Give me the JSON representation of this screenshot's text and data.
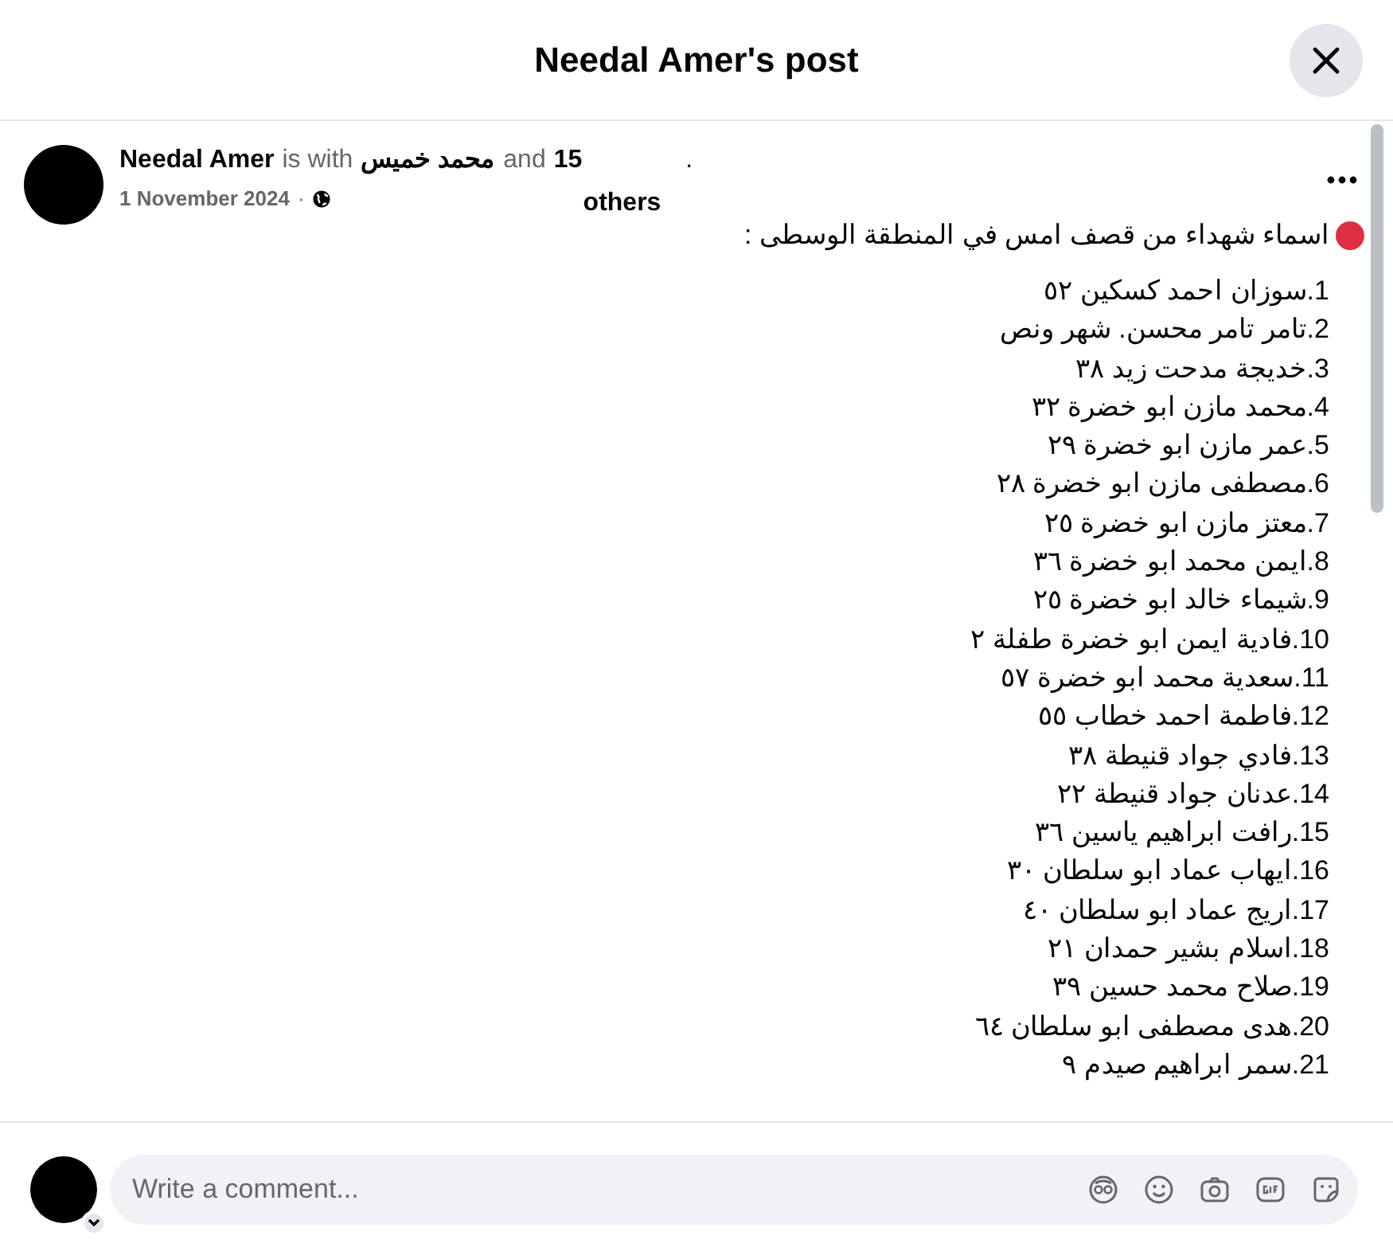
{
  "dialog": {
    "title": "Needal Amer's post"
  },
  "post": {
    "author": "Needal Amer",
    "with_text": "is with",
    "tagged": "محمد خميس",
    "and_text": "and",
    "count": "15",
    "dot": ".",
    "others": "others",
    "date": "1 November 2024",
    "separator": "·",
    "headline": "اسماء شهداء من قصف امس في المنطقة الوسطى  :",
    "lines": [
      "1.سوزان احمد كسكين ٥٢",
      "2.تامر تامر محسن. شهر ونص",
      "3.خديجة مدحت زيد ٣٨",
      "4.محمد مازن ابو خضرة ٣٢",
      "5.عمر مازن ابو خضرة ٢٩",
      "6.مصطفى مازن ابو خضرة ٢٨",
      "7.معتز مازن ابو خضرة ٢٥",
      "8.ايمن محمد ابو خضرة ٣٦",
      "9.شيماء خالد ابو خضرة ٢٥",
      "10.فادية ايمن ابو خضرة طفلة ٢",
      "11.سعدية محمد ابو خضرة ٥٧",
      "12.فاطمة احمد خطاب ٥٥",
      "13.فادي جواد قنيطة ٣٨",
      "14.عدنان جواد قنيطة ٢٢",
      "15.رافت ابراهيم ياسين ٣٦",
      "16.ايهاب عماد ابو سلطان ٣٠",
      "17.اريج عماد ابو سلطان ٤٠",
      "18.اسلام بشير حمدان ٢١",
      "19.صلاح محمد حسين ٣٩",
      "20.هدى مصطفى ابو سلطان ٦٤",
      "21.سمر ابراهيم صيدم ٩"
    ]
  },
  "comment": {
    "placeholder": "Write a comment..."
  }
}
